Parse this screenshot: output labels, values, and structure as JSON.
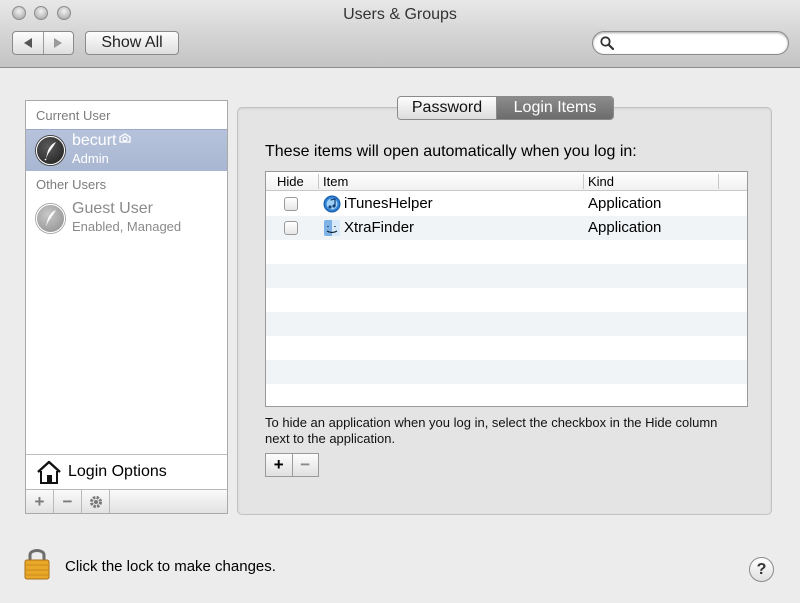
{
  "window": {
    "title": "Users & Groups"
  },
  "toolbar": {
    "show_all_label": "Show All",
    "search": {
      "value": "",
      "placeholder": ""
    }
  },
  "sidebar": {
    "current_user_header": "Current User",
    "other_users_header": "Other Users",
    "users": [
      {
        "name": "becurt",
        "role": "Admin",
        "selected": true
      },
      {
        "name": "Guest User",
        "role": "Enabled, Managed",
        "selected": false
      }
    ],
    "login_options_label": "Login Options",
    "bottom_buttons": [
      "+",
      "−",
      "gear"
    ]
  },
  "tabs": [
    {
      "label": "Password",
      "selected": false
    },
    {
      "label": "Login Items",
      "selected": true
    }
  ],
  "login_items": {
    "heading": "These items will open automatically when you log in:",
    "columns": [
      "Hide",
      "Item",
      "Kind"
    ],
    "rows": [
      {
        "hide": false,
        "item": "iTunesHelper",
        "kind": "Application",
        "icon": "itunes-icon"
      },
      {
        "hide": false,
        "item": "XtraFinder",
        "kind": "Application",
        "icon": "finder-icon"
      }
    ],
    "hint": "To hide an application when you log in, select the checkbox in the Hide column next to the application.",
    "add_label": "+",
    "remove_label": "−"
  },
  "footer": {
    "lock_text": "Click the lock to make changes.",
    "help_label": "?"
  },
  "colors": {
    "selection": "#aab7d2",
    "tab_selected": "#7a7a7a",
    "window_bg": "#ececec"
  }
}
